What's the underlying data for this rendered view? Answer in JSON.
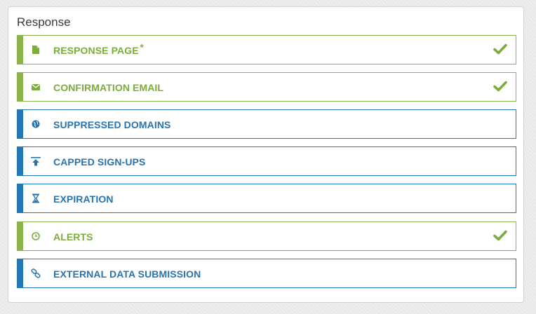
{
  "panel": {
    "title": "Response"
  },
  "colors": {
    "done": "#7aad3a",
    "todo": "#2a73ad"
  },
  "items": [
    {
      "label": "RESPONSE PAGE",
      "required_mark": "*",
      "icon": "file-icon",
      "status": "complete"
    },
    {
      "label": "CONFIRMATION EMAIL",
      "icon": "envelope-icon",
      "status": "complete"
    },
    {
      "label": "SUPPRESSED DOMAINS",
      "icon": "globe-icon",
      "status": "incomplete"
    },
    {
      "label": "CAPPED SIGN-UPS",
      "icon": "upload-arrow-icon",
      "status": "incomplete"
    },
    {
      "label": "EXPIRATION",
      "icon": "hourglass-icon",
      "status": "incomplete"
    },
    {
      "label": "ALERTS",
      "icon": "clock-icon",
      "status": "complete"
    },
    {
      "label": "EXTERNAL DATA SUBMISSION",
      "icon": "link-icon",
      "status": "incomplete"
    }
  ]
}
